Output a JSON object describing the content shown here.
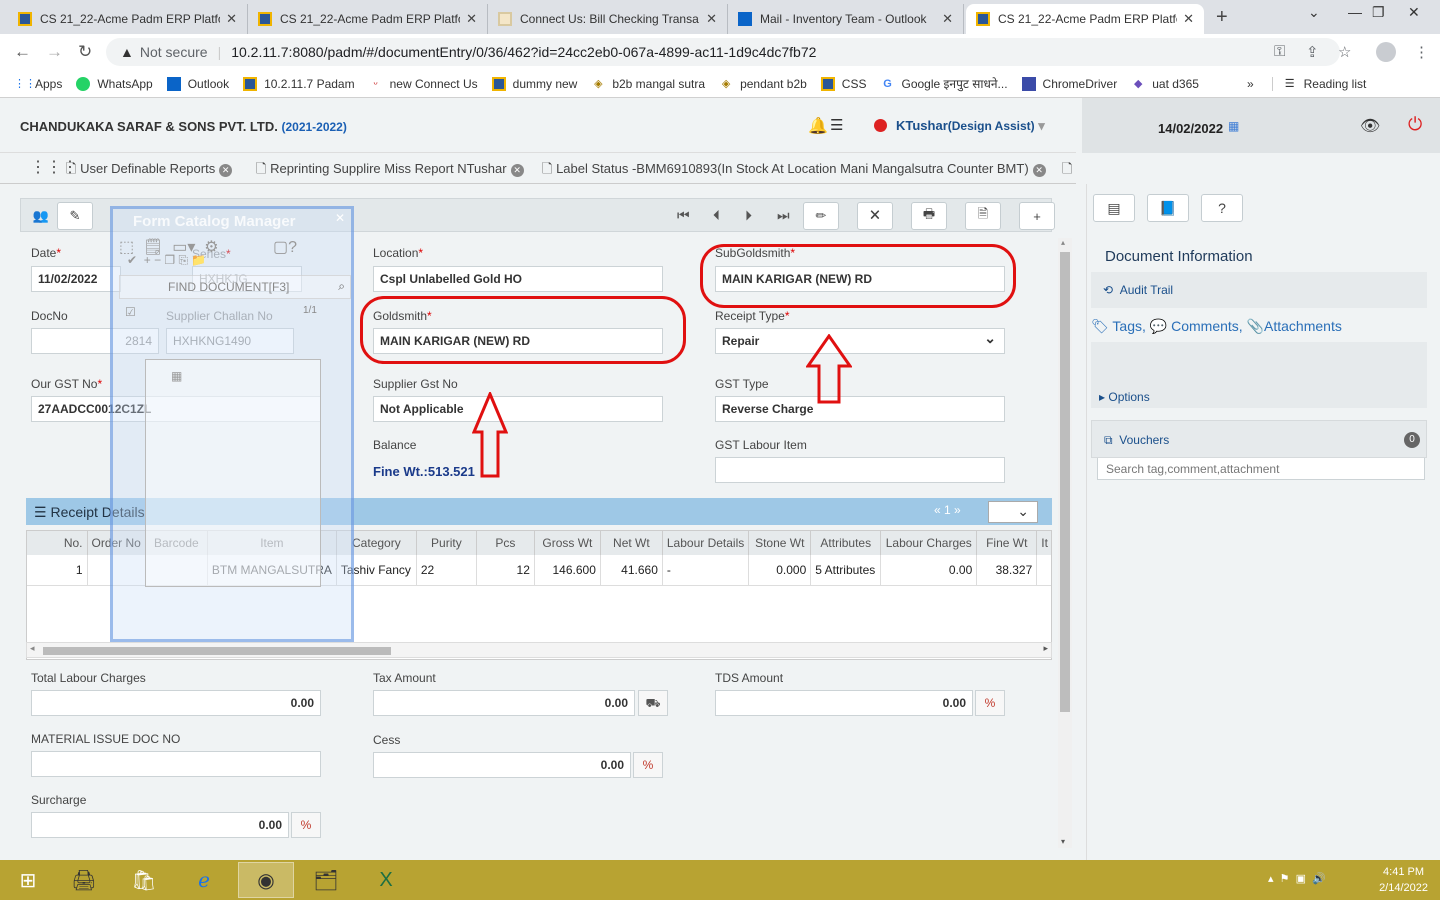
{
  "browser": {
    "tabs": [
      {
        "title": "CS 21_22-Acme Padm ERP Platfo",
        "icon": "padm"
      },
      {
        "title": "CS 21_22-Acme Padm ERP Platfo",
        "icon": "padm"
      },
      {
        "title": "Connect Us: Bill Checking Transa",
        "icon": "connect"
      },
      {
        "title": "Mail - Inventory Team - Outlook",
        "icon": "outlook"
      },
      {
        "title": "CS 21_22-Acme Padm ERP Platfo",
        "icon": "padm"
      }
    ],
    "security": "Not secure",
    "url": "10.2.11.7:8080/padm/#/documentEntry/0/36/462?id=24cc2eb0-067a-4899-ac11-1d9c4dc7fb72",
    "bookmarks": [
      "Apps",
      "WhatsApp",
      "Outlook",
      "10.2.11.7 Padam",
      "new Connect Us",
      "dummy new",
      "b2b mangal sutra",
      "pendant b2b",
      "CSS",
      "Google इनपुट साधने...",
      "ChromeDriver",
      "uat d365"
    ],
    "bookmarks_more": "»",
    "reading_list": "Reading list"
  },
  "header": {
    "company": "CHANDUKAKA SARAF & SONS PVT. LTD.",
    "year": "(2021-2022)",
    "user": "KTushar",
    "role": "(Design Assist)",
    "date": "14/02/2022"
  },
  "doc_tabs": [
    "User Definable Reports",
    "Reprinting Supplire Miss Report NTushar",
    "Label Status -BMM6910893(In Stock At Location Mani Mangalsutra Counter BMT)"
  ],
  "overlay": {
    "title": "Form Catalog Manager",
    "search_placeholder": "FIND DOCUMENT[F3]",
    "page": "1/1"
  },
  "form": {
    "date_label": "Date",
    "date": "11/02/2022",
    "series_label": "Series",
    "series": "HXHKJG",
    "docno_label": "DocNo",
    "docno": "2814",
    "challan_label": "Supplier Challan No",
    "challan": "HXHKNG1490",
    "gst_label": "Our GST No",
    "gst": "27AADCC0012C1ZL",
    "location_label": "Location",
    "location": "Cspl Unlabelled Gold HO",
    "goldsmith_label": "Goldsmith",
    "goldsmith": "MAIN KARIGAR (NEW) RD",
    "supplier_gst_label": "Supplier Gst No",
    "supplier_gst": "Not Applicable",
    "balance_label": "Balance",
    "balance": "Fine Wt.:513.521",
    "subgoldsmith_label": "SubGoldsmith",
    "subgoldsmith": "MAIN KARIGAR (NEW) RD",
    "receipt_type_label": "Receipt Type",
    "receipt_type": "Repair",
    "gst_type_label": "GST Type",
    "gst_type": "Reverse Charge",
    "gst_labour_label": "GST Labour Item",
    "gst_labour": ""
  },
  "receipt": {
    "title": "Receipt Details",
    "pager": "«  1  »",
    "columns": [
      "No.",
      "Order No",
      "Barcode",
      "Item",
      "Category",
      "Purity",
      "Pcs",
      "Gross Wt",
      "Net Wt",
      "Labour Details",
      "Stone Wt",
      "Attributes",
      "Labour Charges",
      "Fine Wt",
      "It"
    ],
    "rows": [
      [
        "1",
        "",
        "",
        "BTM MANGALSUTRA",
        "Tashiv Fancy",
        "22",
        "12",
        "146.600",
        "41.660",
        "-",
        "0.000",
        "5 Attributes",
        "0.00",
        "38.327",
        ""
      ]
    ]
  },
  "totals": {
    "labour_label": "Total Labour Charges",
    "labour": "0.00",
    "tax_label": "Tax Amount",
    "tax": "0.00",
    "tds_label": "TDS Amount",
    "tds": "0.00",
    "material_label": "MATERIAL ISSUE DOC NO",
    "material": "",
    "cess_label": "Cess",
    "cess": "0.00",
    "surcharge_label": "Surcharge",
    "surcharge": "0.00",
    "pct": "%"
  },
  "right_panel": {
    "title": "Document Information",
    "audit": "Audit Trail",
    "tags": "Tags,",
    "comments": "Comments,",
    "attachments": "Attachments",
    "search_placeholder": "Search tag,comment,attachment",
    "options": "Options",
    "vouchers": "Vouchers",
    "voucher_count": "0"
  },
  "taskbar": {
    "time": "4:41 PM",
    "date": "2/14/2022"
  },
  "colors": {
    "annotation": "#e01010",
    "accent": "#1a5fb4",
    "grid_header": "#9ec8e6",
    "taskbar": "#b8a332"
  }
}
